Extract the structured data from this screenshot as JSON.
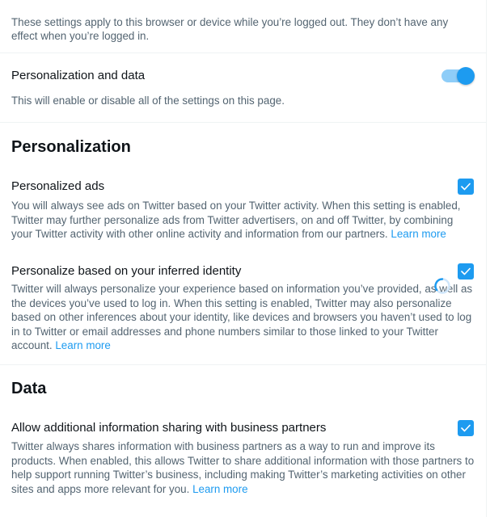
{
  "intro": {
    "text": "These settings apply to this browser or device while you’re logged out. They don’t have any effect when you’re logged in."
  },
  "master": {
    "title": "Personalization and data",
    "description": "This will enable or disable all of the settings on this page.",
    "toggle_on": true
  },
  "sections": {
    "personalization": "Personalization",
    "data": "Data"
  },
  "settings": {
    "personalized_ads": {
      "title": "Personalized ads",
      "description": "You will always see ads on Twitter based on your Twitter activity. When this setting is enabled, Twitter may further personalize ads from Twitter advertisers, on and off Twitter, by combining your Twitter activity with other online activity and information from our partners.",
      "link": "Learn more",
      "checked": true
    },
    "inferred_identity": {
      "title": "Personalize based on your inferred identity",
      "description": "Twitter will always personalize your experience based on information you’ve provided, as well as the devices you’ve used to log in. When this setting is enabled, Twitter may also personalize based on other inferences about your identity, like devices and browsers you haven’t used to log in to Twitter or email addresses and phone numbers similar to those linked to your Twitter account.",
      "link": "Learn more",
      "checked": true
    },
    "info_sharing": {
      "title": "Allow additional information sharing with business partners",
      "description": "Twitter always shares information with business partners as a way to run and improve its products. When enabled, this allows Twitter to share additional information with those partners to help support running Twitter’s business, including making Twitter’s marketing activities on other sites and apps more relevant for you.",
      "link": "Learn more",
      "checked": true
    }
  },
  "colors": {
    "accent": "#1d9bf0",
    "text_primary": "#0f1419",
    "text_secondary": "#536471",
    "divider": "#eff3f4"
  },
  "icons": {
    "toggle": "toggle-switch",
    "checkbox": "checkmark-icon",
    "cursor": "loading-cursor-icon"
  }
}
